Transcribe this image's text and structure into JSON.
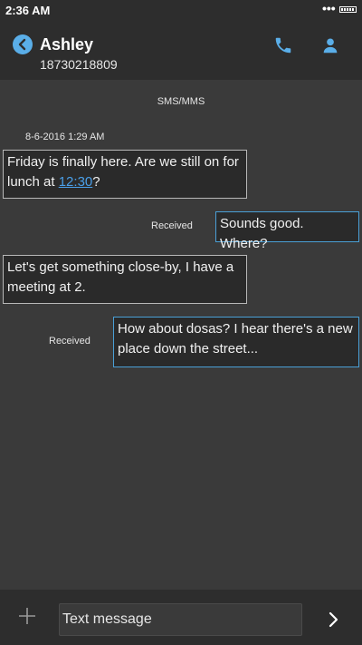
{
  "status_bar": {
    "time": "2:36 AM",
    "dots": "•••"
  },
  "header": {
    "contact_name": "Ashley",
    "contact_number": "18730218809"
  },
  "thread": {
    "protocol_label": "SMS/MMS",
    "timestamp": "8-6-2016 1:29 AM",
    "messages": [
      {
        "direction": "incoming",
        "text_before": "Friday is finally here. Are we still on for lunch at ",
        "link_text": "12:30",
        "text_after": "?"
      },
      {
        "direction": "outgoing",
        "status": "Received",
        "text": "Sounds good. Where?"
      },
      {
        "direction": "incoming",
        "text": "Let's get something close-by, I have a meeting at 2."
      },
      {
        "direction": "outgoing",
        "status": "Received",
        "text": "How about dosas? I hear there's a new place down the street..."
      }
    ]
  },
  "composer": {
    "placeholder": "Text message"
  },
  "icons": {
    "back": "back-arrow-icon",
    "call": "phone-icon",
    "profile": "person-icon",
    "add": "plus-icon",
    "send": "chevron-right-icon"
  },
  "colors": {
    "accent": "#4a9fd6",
    "background": "#3a3a3a",
    "bar": "#2d2d2d"
  }
}
